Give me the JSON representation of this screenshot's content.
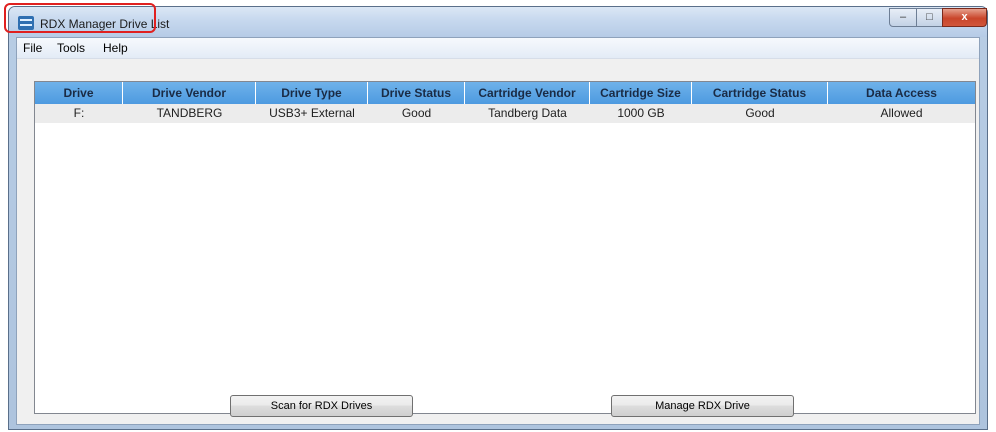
{
  "window": {
    "title": "RDX Manager Drive List",
    "controls": {
      "minimize": "–",
      "maximize": "□",
      "close": "x"
    }
  },
  "menu": {
    "items": [
      "File",
      "Tools",
      "Help"
    ]
  },
  "table": {
    "columns": [
      "Drive",
      "Drive Vendor",
      "Drive Type",
      "Drive Status",
      "Cartridge Vendor",
      "Cartridge Size",
      "Cartridge Status",
      "Data Access"
    ],
    "rows": [
      [
        "F:",
        "TANDBERG",
        "USB3+ External",
        "Good",
        "Tandberg Data",
        "1000 GB",
        "Good",
        "Allowed"
      ]
    ]
  },
  "buttons": {
    "scan": "Scan for RDX Drives",
    "manage": "Manage RDX Drive"
  },
  "colors": {
    "header_blue": "#4d9ae0",
    "highlight_red": "#e0201f"
  }
}
